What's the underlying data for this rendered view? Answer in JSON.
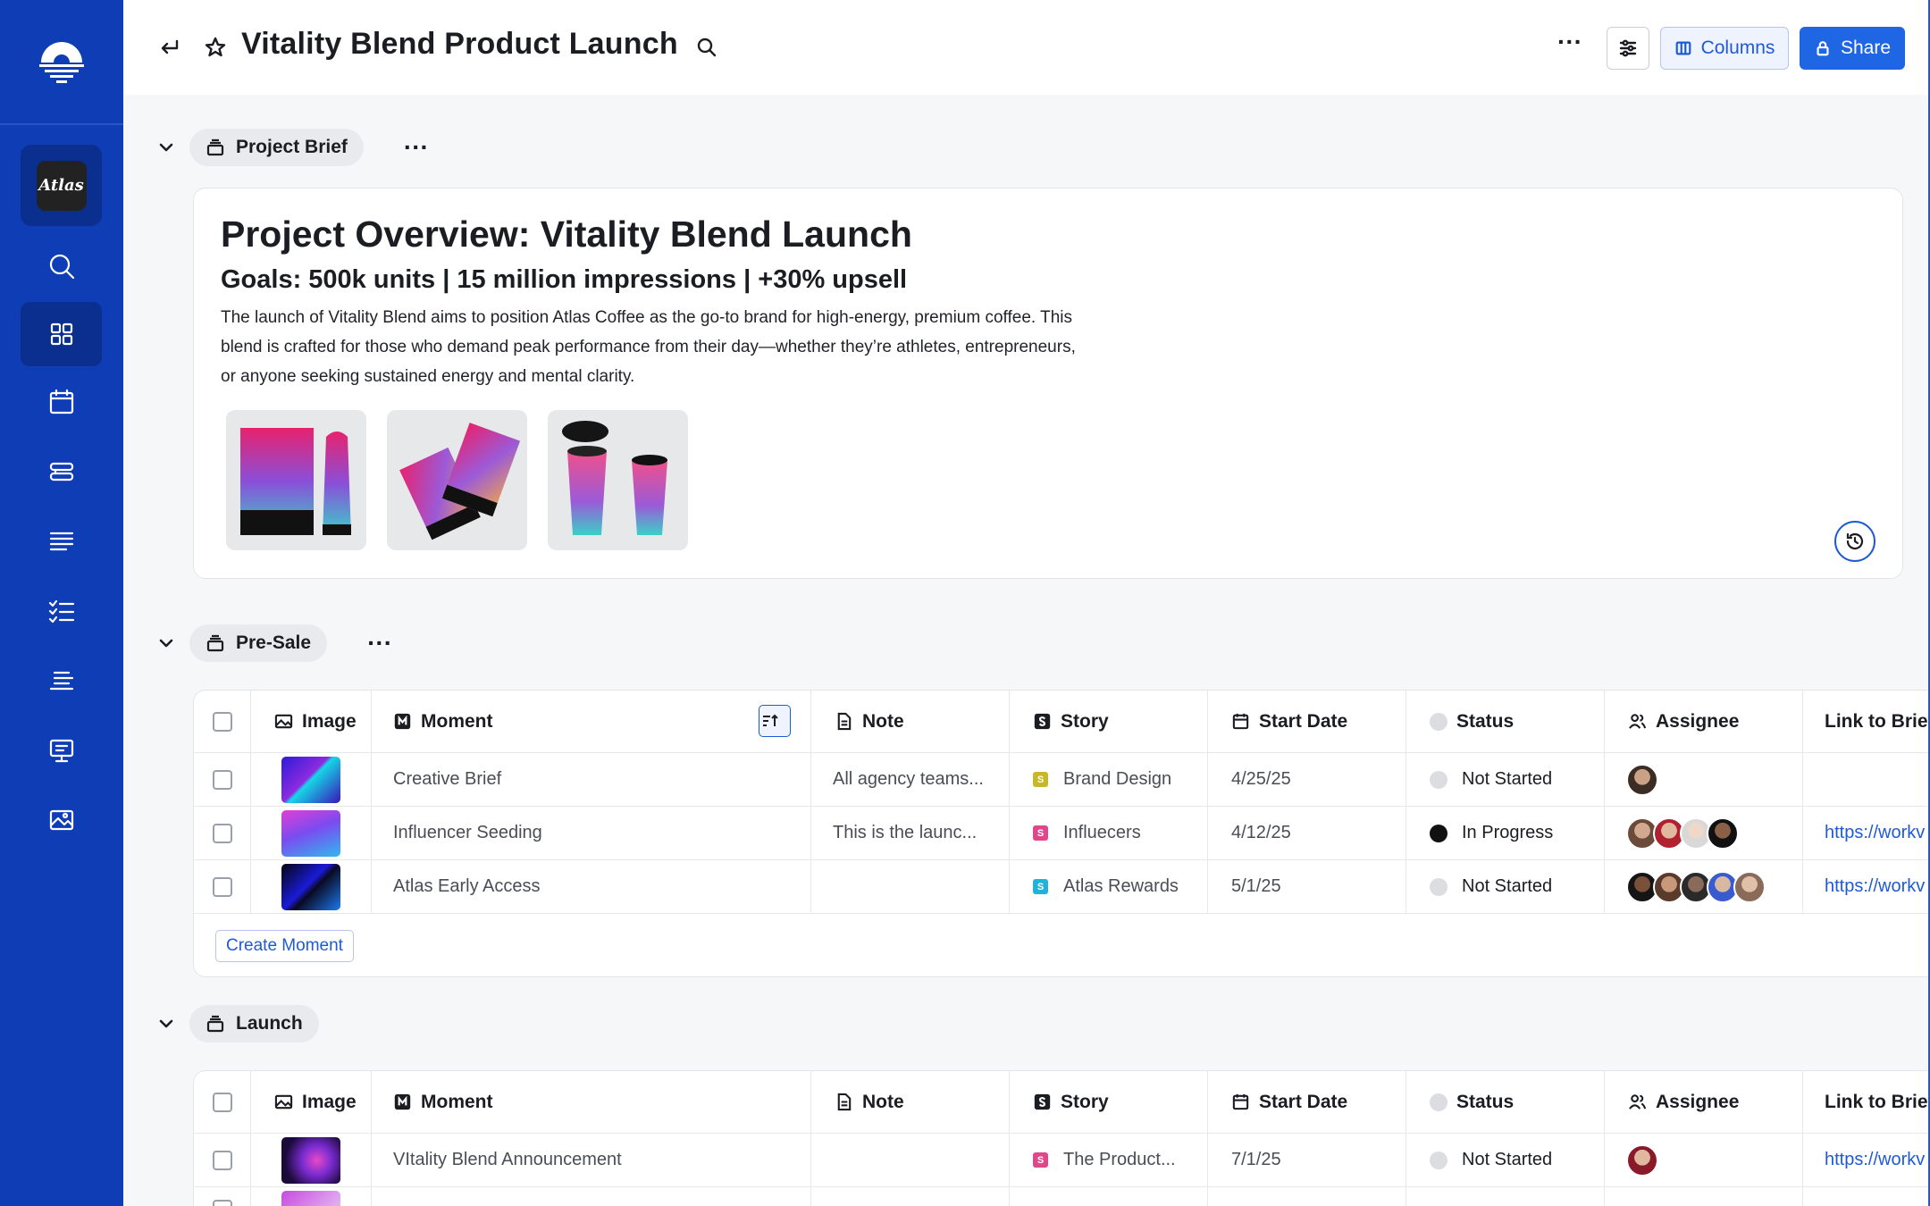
{
  "app": {
    "brand_badge": "Atlas"
  },
  "topbar": {
    "title": "Vitality Blend Product Launch",
    "columns_label": "Columns",
    "share_label": "Share"
  },
  "sections": {
    "brief": {
      "label": "Project Brief"
    },
    "presale": {
      "label": "Pre-Sale"
    },
    "launch": {
      "label": "Launch"
    }
  },
  "brief": {
    "heading": "Project Overview: Vitality Blend Launch",
    "goals": "Goals: 500k units | 15 million impressions | +30% upsell",
    "body": "The launch of Vitality Blend aims to position Atlas Coffee as the go-to brand for high-energy, premium coffee. This blend is crafted for those who demand peak performance from their day—whether they’re athletes, entrepreneurs, or anyone seeking sustained energy and mental clarity."
  },
  "columns": {
    "image": "Image",
    "moment": "Moment",
    "note": "Note",
    "story": "Story",
    "start_date": "Start Date",
    "status": "Status",
    "assignee": "Assignee",
    "link": "Link to Brief"
  },
  "presale_rows": [
    {
      "moment": "Creative Brief",
      "note": "All agency teams...",
      "story": "Brand Design",
      "story_letter": "S",
      "story_color": "#c9b825",
      "date": "4/25/25",
      "status": "Not Started",
      "status_color": "#dcdde0",
      "link": ""
    },
    {
      "moment": "Influencer Seeding",
      "note": "This is the launc...",
      "story": "Influecers",
      "story_letter": "S",
      "story_color": "#e0478a",
      "date": "4/12/25",
      "status": "In Progress",
      "status_color": "#111111",
      "link": "https://workv"
    },
    {
      "moment": "Atlas Early Access",
      "note": "",
      "story": "Atlas Rewards",
      "story_letter": "S",
      "story_color": "#22b2d9",
      "date": "5/1/25",
      "status": "Not Started",
      "status_color": "#dcdde0",
      "link": "https://workv"
    }
  ],
  "create_label": "Create Moment",
  "launch_rows": [
    {
      "moment": "VItality Blend Announcement",
      "note": "",
      "story": "The Product...",
      "story_letter": "S",
      "story_color": "#e0478a",
      "date": "7/1/25",
      "status": "Not Started",
      "status_color": "#dcdde0",
      "link": "https://workv"
    }
  ],
  "colors": {
    "rail": "#0e3db6",
    "accent": "#1f66e5"
  }
}
